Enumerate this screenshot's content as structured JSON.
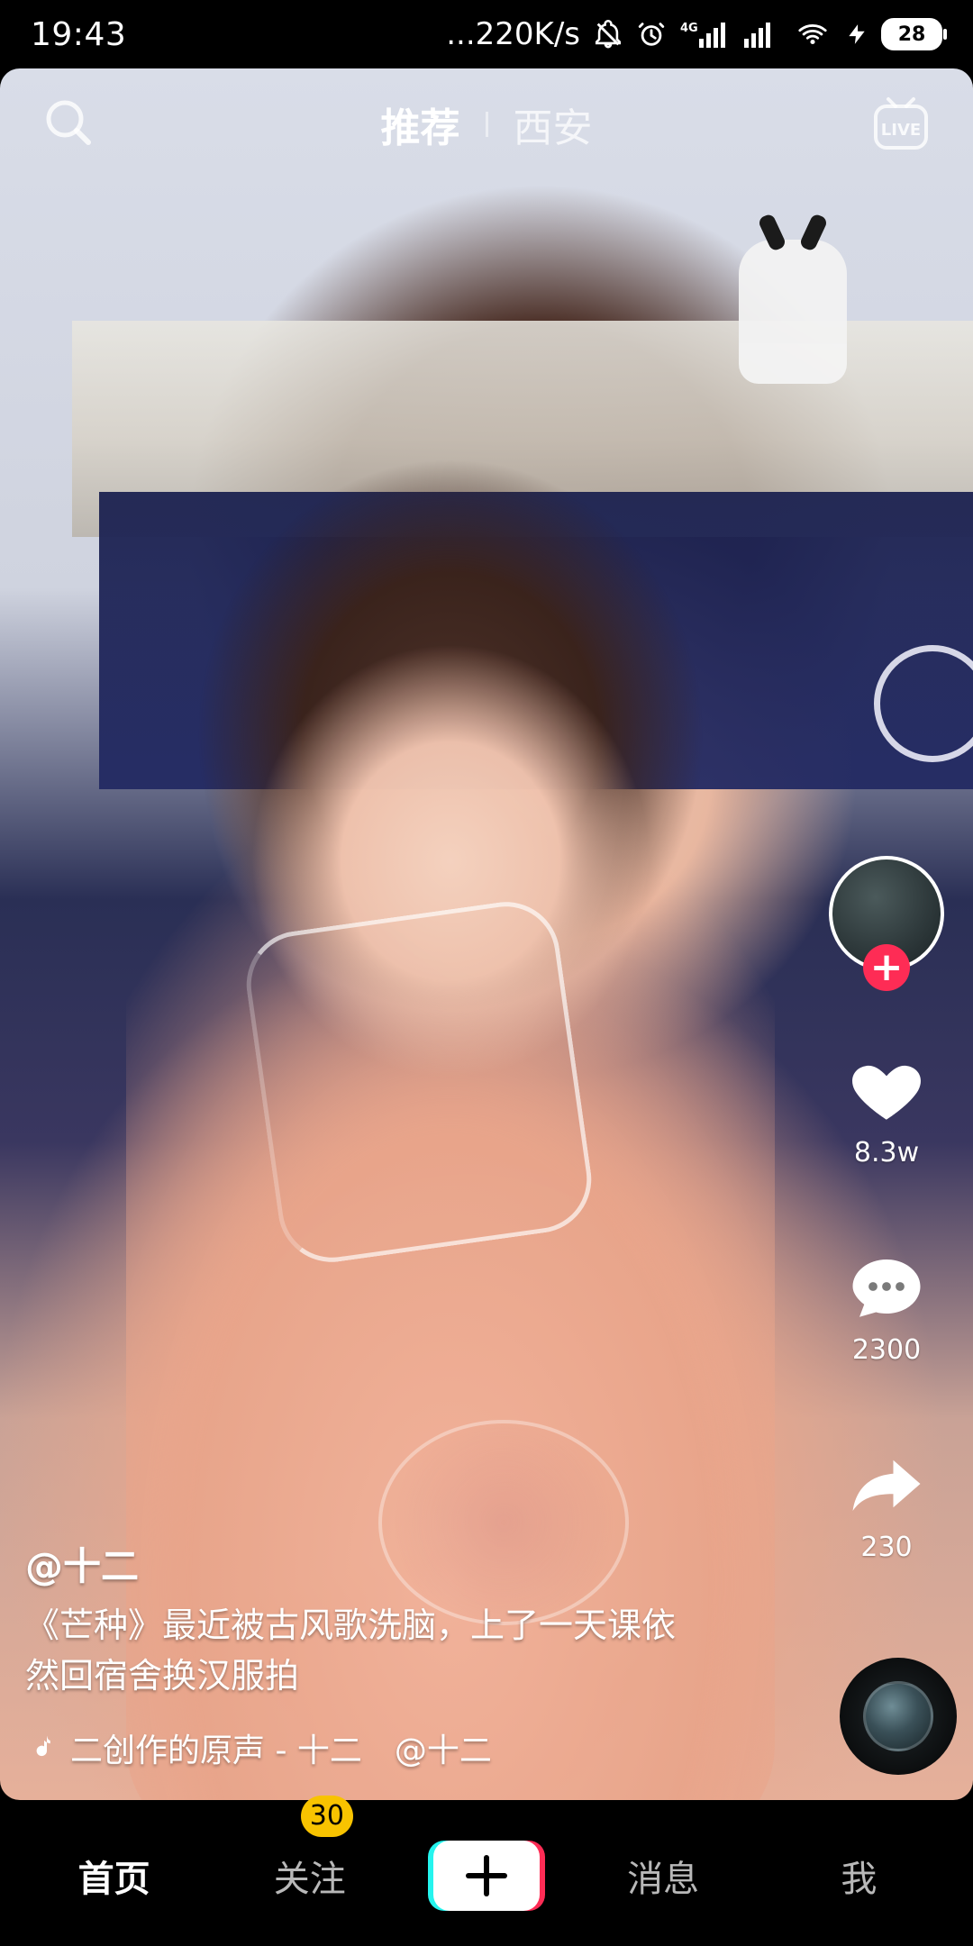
{
  "status_bar": {
    "time": "19:43",
    "network_speed": "...220K/s",
    "battery_level": "28",
    "icons": [
      "mute-bell-icon",
      "alarm-icon",
      "cell-4g-icon",
      "cell-signal-icon",
      "wifi-icon",
      "charging-icon",
      "battery-icon"
    ]
  },
  "top_nav": {
    "search_icon": "search-icon",
    "tabs": [
      {
        "label": "推荐",
        "active": true
      },
      {
        "label": "西安",
        "active": false
      }
    ],
    "live_icon": "live-icon"
  },
  "rail": {
    "like_count": "8.3w",
    "comment_count": "2300",
    "share_count": "230",
    "colors": {
      "follow_plus": "#fe2c55"
    }
  },
  "caption": {
    "author": "@十二",
    "description": "《芒种》最近被古风歌洗脑，上了一天课依\n然回宿舍换汉服拍",
    "music": "二创作的原声 - 十二　@十二"
  },
  "tabbar": {
    "items": [
      {
        "label": "首页",
        "active": true
      },
      {
        "label": "关注",
        "active": false,
        "badge": "30"
      },
      {
        "label": "消息",
        "active": false
      },
      {
        "label": "我",
        "active": false
      }
    ],
    "create_icon": "plus-icon",
    "colors": {
      "badge": "#f8c300",
      "create_left": "#25f4ee",
      "create_right": "#fe2c55"
    }
  }
}
